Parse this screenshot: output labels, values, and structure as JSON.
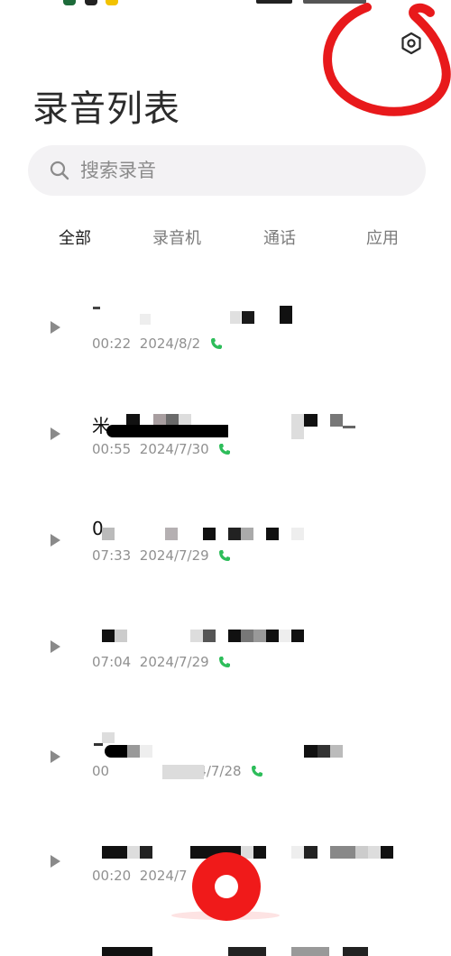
{
  "header": {
    "title": "录音列表",
    "settings_icon": "hexagon-settings-icon"
  },
  "search": {
    "placeholder": "搜索录音",
    "value": ""
  },
  "tabs": [
    {
      "label": "全部",
      "active": true
    },
    {
      "label": "录音机",
      "active": false
    },
    {
      "label": "通话",
      "active": false
    },
    {
      "label": "应用",
      "active": false
    }
  ],
  "recordings": [
    {
      "title": "",
      "duration": "00:22",
      "date": "2024/8/2",
      "type": "call"
    },
    {
      "title": "米",
      "duration": "00:55",
      "date": "2024/7/30",
      "type": "call"
    },
    {
      "title": "0",
      "duration": "07:33",
      "date": "2024/7/29",
      "type": "call"
    },
    {
      "title": "",
      "duration": "07:04",
      "date": "2024/7/29",
      "type": "call"
    },
    {
      "title": "",
      "duration": "00",
      "date": "2024/7/28",
      "type": "call"
    },
    {
      "title": "",
      "duration": "00:20",
      "date": "2024/7",
      "type": "call"
    }
  ],
  "colors": {
    "accent_red": "#f01a1a",
    "call_green": "#2dbd5a",
    "annotation_red": "#e8191b"
  },
  "fab": {
    "icon": "record-icon"
  }
}
